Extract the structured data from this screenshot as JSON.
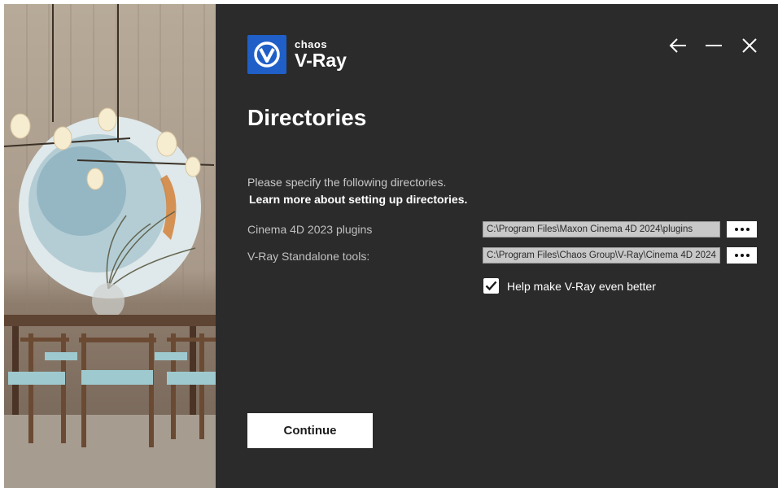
{
  "brand": {
    "company": "chaos",
    "product": "V-Ray",
    "logo_icon": "v-ray-logo-icon",
    "accent": "#1f5fc7"
  },
  "window_controls": {
    "back_icon": "arrow-left-icon",
    "minimize_icon": "minimize-icon",
    "close_icon": "close-icon"
  },
  "page": {
    "title": "Directories",
    "intro": "Please specify the following directories.",
    "learn_more": "Learn more about setting up directories."
  },
  "directories": [
    {
      "label": "Cinema 4D 2023 plugins",
      "value": "C:\\Program Files\\Maxon Cinema 4D 2024\\plugins",
      "browse_icon": "ellipsis-icon"
    },
    {
      "label": "V-Ray Standalone tools:",
      "value": "C:\\Program Files\\Chaos Group\\V-Ray\\Cinema 4D 2024",
      "browse_icon": "ellipsis-icon"
    }
  ],
  "telemetry": {
    "label": "Help make V-Ray even better",
    "checked": true
  },
  "actions": {
    "continue": "Continue"
  },
  "colors": {
    "panel_bg": "#2b2b2b",
    "text": "#ffffff",
    "muted": "#c0c0c0"
  }
}
